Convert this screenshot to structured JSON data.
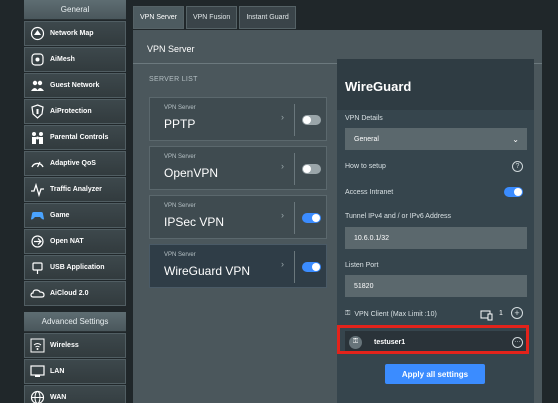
{
  "sidebar": {
    "general_title": "General",
    "general_items": [
      {
        "label": "Network Map",
        "icon": "network-map-icon"
      },
      {
        "label": "AiMesh",
        "icon": "aimesh-icon"
      },
      {
        "label": "Guest Network",
        "icon": "guest-network-icon"
      },
      {
        "label": "AiProtection",
        "icon": "shield-icon"
      },
      {
        "label": "Parental Controls",
        "icon": "family-icon"
      },
      {
        "label": "Adaptive QoS",
        "icon": "gauge-icon"
      },
      {
        "label": "Traffic Analyzer",
        "icon": "pulse-icon"
      },
      {
        "label": "Game",
        "icon": "gamepad-icon"
      },
      {
        "label": "Open NAT",
        "icon": "nat-icon"
      },
      {
        "label": "USB Application",
        "icon": "usb-icon"
      },
      {
        "label": "AiCloud 2.0",
        "icon": "cloud-icon"
      }
    ],
    "advanced_title": "Advanced Settings",
    "advanced_items": [
      {
        "label": "Wireless",
        "icon": "wifi-icon"
      },
      {
        "label": "LAN",
        "icon": "lan-icon"
      },
      {
        "label": "WAN",
        "icon": "globe-icon"
      }
    ]
  },
  "tabs": [
    {
      "label": "VPN Server",
      "active": true
    },
    {
      "label": "VPN Fusion",
      "active": false
    },
    {
      "label": "Instant Guard",
      "active": false
    }
  ],
  "main": {
    "title": "VPN Server",
    "server_list_title": "SERVER LIST",
    "servers": [
      {
        "small_label": "VPN Server",
        "name": "PPTP",
        "enabled": false,
        "selected": false
      },
      {
        "small_label": "VPN Server",
        "name": "OpenVPN",
        "enabled": false,
        "selected": false
      },
      {
        "small_label": "VPN Server",
        "name": "IPSec VPN",
        "enabled": true,
        "selected": false
      },
      {
        "small_label": "VPN Server",
        "name": "WireGuard VPN",
        "enabled": true,
        "selected": true
      }
    ]
  },
  "detail": {
    "title": "WireGuard",
    "vpn_details_label": "VPN Details",
    "vpn_details_value": "General",
    "how_to_setup_label": "How to setup",
    "access_intranet_label": "Access Intranet",
    "access_intranet_enabled": true,
    "tunnel_label": "Tunnel IPv4 and / or IPv6 Address",
    "tunnel_value": "10.6.0.1/32",
    "listen_port_label": "Listen Port",
    "listen_port_value": "51820",
    "vpn_client_label": "VPN Client (Max Limit :10)",
    "vpn_client_count": "1",
    "client_name": "testuser1",
    "apply_label": "Apply all settings"
  },
  "colors": {
    "accent": "#3b8cff",
    "highlight": "#e3231b"
  }
}
